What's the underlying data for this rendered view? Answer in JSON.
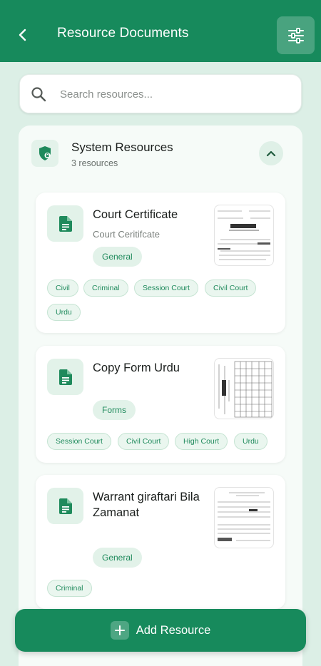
{
  "colors": {
    "primary": "#178a5c",
    "accent_light": "#e2f2e9",
    "background": "#dcefe6"
  },
  "header": {
    "title": "Resource Documents",
    "back_icon": "arrow-back-icon",
    "filter_icon": "tune-sliders-icon"
  },
  "search": {
    "placeholder": "Search resources...",
    "value": ""
  },
  "section": {
    "title": "System Resources",
    "count": "3 resources",
    "icon": "shield-lock-icon",
    "toggle_icon": "chevron-up-icon"
  },
  "resources": [
    {
      "title": "Court Certificate",
      "subtitle": "Court Ceritifcate",
      "type": "General",
      "tags": [
        "Civil",
        "Criminal",
        "Session Court",
        "Civil Court",
        "Urdu"
      ]
    },
    {
      "title": "Copy Form Urdu",
      "subtitle": "",
      "type": "Forms",
      "tags": [
        "Session Court",
        "Civil Court",
        "High Court",
        "Urdu"
      ]
    },
    {
      "title": "Warrant giraftari Bila Zamanat",
      "subtitle": "",
      "type": "General",
      "tags": [
        "Criminal"
      ]
    }
  ],
  "actions": {
    "add_label": "Add Resource",
    "add_icon": "plus-icon"
  }
}
